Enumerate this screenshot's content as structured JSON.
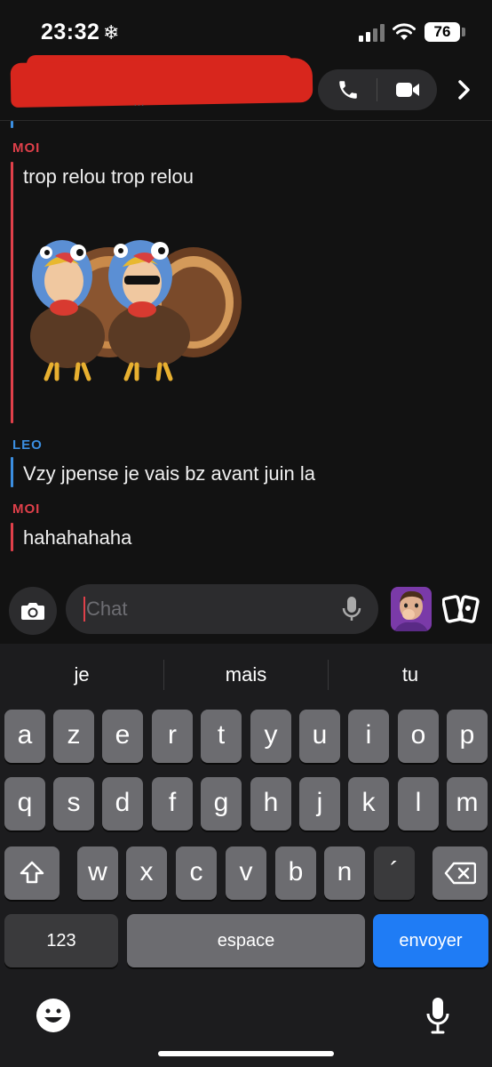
{
  "status_bar": {
    "time": "23:32",
    "battery": "76"
  },
  "header": {
    "subtitle": "…"
  },
  "messages": [
    {
      "sender": "MOI",
      "text": "trop relou trop relou"
    },
    {
      "sender": "LEO",
      "text": "Vzy jpense je vais bz avant juin la"
    },
    {
      "sender": "MOI",
      "text": "hahahahaha"
    }
  ],
  "chat_input": {
    "placeholder": "Chat"
  },
  "keyboard": {
    "suggestions": [
      "je",
      "mais",
      "tu"
    ],
    "row1": [
      "a",
      "z",
      "e",
      "r",
      "t",
      "y",
      "u",
      "i",
      "o",
      "p"
    ],
    "row2": [
      "q",
      "s",
      "d",
      "f",
      "g",
      "h",
      "j",
      "k",
      "l",
      "m"
    ],
    "row3": [
      "w",
      "x",
      "c",
      "v",
      "b",
      "n",
      "´"
    ],
    "numbers_key": "123",
    "space_key": "espace",
    "send_key": "envoyer"
  },
  "colors": {
    "moi": "#e0404a",
    "leo": "#3b8ee0",
    "send": "#1f7cf5"
  },
  "icons": [
    "snowflake-icon",
    "phone-icon",
    "video-icon",
    "chevron-right-icon",
    "camera-icon",
    "microphone-icon",
    "cards-icon",
    "shift-icon",
    "backspace-icon",
    "emoji-icon"
  ]
}
